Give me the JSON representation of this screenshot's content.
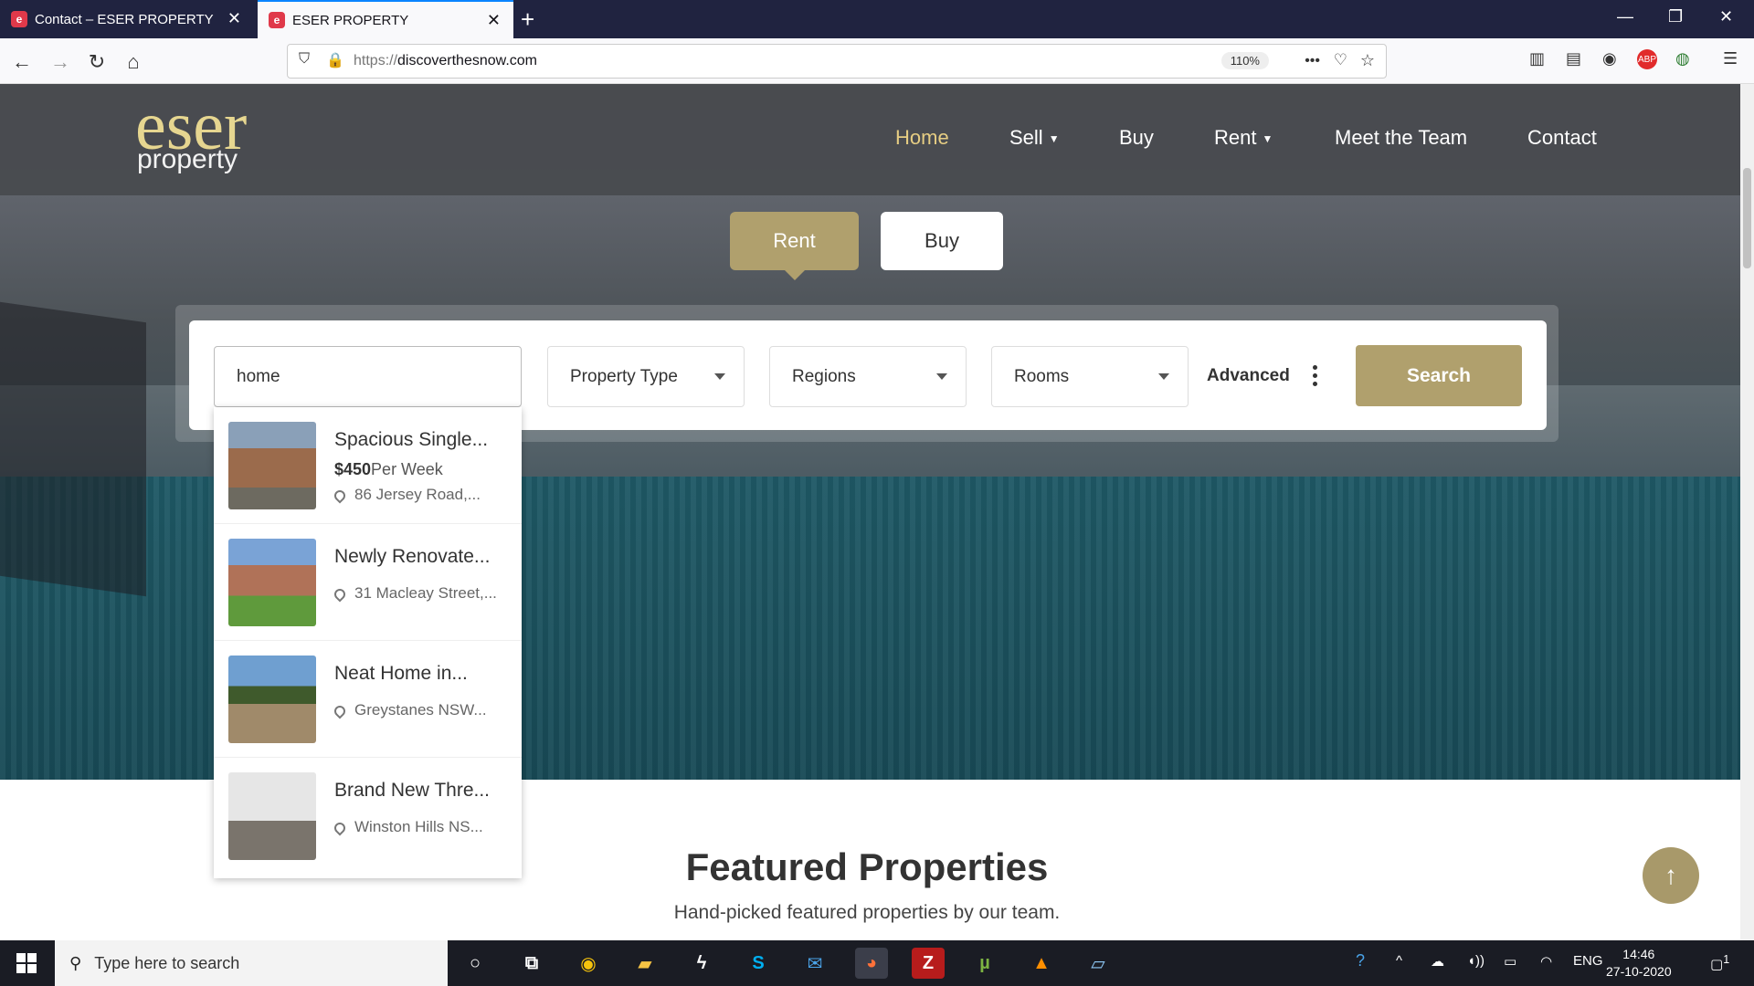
{
  "browser": {
    "tabs": [
      {
        "title": "Contact – ESER PROPERTY",
        "favicon": "eser-favicon"
      },
      {
        "title": "ESER PROPERTY",
        "favicon": "eser-favicon"
      }
    ],
    "url_prefix": "https://",
    "url_domain": "discoverthesnow.com",
    "zoom": "110%"
  },
  "site": {
    "logo_top": "eser",
    "logo_bottom": "property",
    "nav": [
      {
        "label": "Home",
        "active": true
      },
      {
        "label": "Sell",
        "has_dropdown": true
      },
      {
        "label": "Buy"
      },
      {
        "label": "Rent",
        "has_dropdown": true
      },
      {
        "label": "Meet the Team"
      },
      {
        "label": "Contact"
      }
    ],
    "mode_tabs": [
      "Rent",
      "Buy"
    ],
    "search": {
      "query": "home",
      "property_type": "Property Type",
      "regions": "Regions",
      "rooms": "Rooms",
      "advanced": "Advanced",
      "button": "Search"
    },
    "suggestions": [
      {
        "title": "Spacious Single...",
        "price": "$450",
        "price_unit": "Per Week",
        "address": "86 Jersey Road,..."
      },
      {
        "title": "Newly Renovate...",
        "address": "31 Macleay Street,..."
      },
      {
        "title": "Neat Home in...",
        "address": "Greystanes NSW..."
      },
      {
        "title": "Brand New Thre...",
        "address": "Winston Hills NS..."
      }
    ],
    "featured_title": "Featured Properties",
    "featured_subtitle": "Hand-picked featured properties by our team."
  },
  "taskbar": {
    "search_placeholder": "Type here to search",
    "lang": "ENG",
    "time": "14:46",
    "date": "27-10-2020",
    "notification_count": "1"
  },
  "colors": {
    "accent": "#b0a06d",
    "nav_active": "#e6cd83",
    "browser_tabbar": "#202340"
  }
}
